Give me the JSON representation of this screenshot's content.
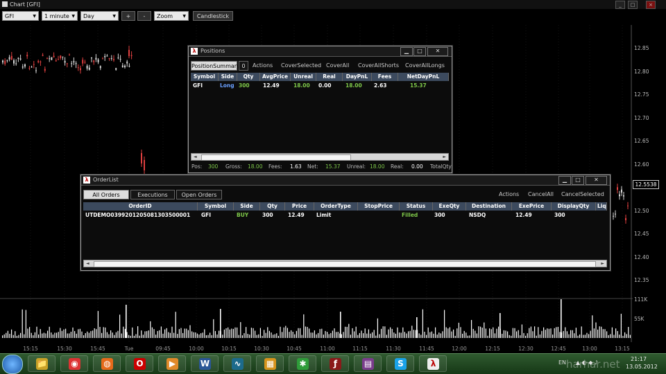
{
  "window": {
    "title": "Chart [GFI]",
    "controls": [
      "_",
      "□",
      "×"
    ]
  },
  "toolbar": {
    "symbol": "GFI",
    "interval": "1 minute",
    "range": "Day",
    "plus": "+",
    "minus": "-",
    "zoom": "Zoom",
    "chart_type": "Candlestick"
  },
  "chart": {
    "price_axis": [
      "12.85",
      "12.80",
      "12.75",
      "12.70",
      "12.65",
      "12.60",
      "12.55",
      "12.50",
      "12.45",
      "12.40",
      "12.35"
    ],
    "volume_axis": [
      "111K",
      "55K"
    ],
    "time_axis": [
      "15:15",
      "15:30",
      "15:45",
      "Tue",
      "09:45",
      "10:00",
      "10:15",
      "10:30",
      "10:45",
      "11:00",
      "11:15",
      "11:30",
      "11:45",
      "12:00",
      "12:15",
      "12:30",
      "12:45",
      "13:00",
      "13:15"
    ],
    "last_price": "12.5538"
  },
  "positions": {
    "title": "Positions",
    "tabs": [
      "PositionSummary",
      "0"
    ],
    "actions": [
      "Actions",
      "CoverSelected",
      "CoverAll",
      "CoverAllShorts",
      "CoverAllLongs"
    ],
    "columns": [
      "Symbol",
      "Side",
      "Qty",
      "AvgPrice",
      "Unreal",
      "Real",
      "DayPnL",
      "Fees",
      "NetDayPnL"
    ],
    "rows": [
      {
        "Symbol": "GFI",
        "Side": "Long",
        "Qty": "300",
        "AvgPrice": "12.49",
        "Unreal": "18.00",
        "Real": "0.00",
        "DayPnL": "18.00",
        "Fees": "2.63",
        "NetDayPnL": "15.37"
      }
    ],
    "footer": [
      {
        "label": "Pos:",
        "value": "300"
      },
      {
        "label": "Gross:",
        "value": "18.00"
      },
      {
        "label": "Fees:",
        "value": "1.63"
      },
      {
        "label": "Net:",
        "value": "15.37"
      },
      {
        "label": "Unreal:",
        "value": "18.00"
      },
      {
        "label": "Real:",
        "value": "0.00"
      },
      {
        "label": "TotalQty",
        "value": ""
      }
    ]
  },
  "orders": {
    "title": "OrderList",
    "tabs": [
      "All Orders",
      "Executions",
      "Open Orders"
    ],
    "actions": [
      "Actions",
      "CancelAll",
      "CancelSelected"
    ],
    "columns": [
      "OrderID",
      "Symbol",
      "Side",
      "Qty",
      "Price",
      "OrderType",
      "StopPrice",
      "Status",
      "ExeQty",
      "Destination",
      "ExePrice",
      "DisplayQty",
      "Liq"
    ],
    "rows": [
      {
        "OrderID": "UTDEMO0399201205081303500001",
        "Symbol": "GFI",
        "Side": "BUY",
        "Qty": "300",
        "Price": "12.49",
        "OrderType": "Limit",
        "StopPrice": "",
        "Status": "Filled",
        "ExeQty": "300",
        "Destination": "NSDQ",
        "ExePrice": "12.49",
        "DisplayQty": "300",
        "Liq": ""
      }
    ]
  },
  "taskbar": {
    "clock_time": "21:17",
    "clock_date": "13.05.2012",
    "lang": "EN",
    "watermark": "harhar.net",
    "apps": [
      "windows-start",
      "explorer",
      "chrome",
      "firefox",
      "opera",
      "media-player",
      "word",
      "trading-app",
      "windows-app",
      "charts-app",
      "flash-app",
      "winrar",
      "skype",
      "lightspeed"
    ]
  },
  "colors": {
    "green": "#7fc94a",
    "blue": "#6aa0ff",
    "up": "#d8d8d8",
    "down": "#e04040",
    "volume": "#ffffff"
  }
}
